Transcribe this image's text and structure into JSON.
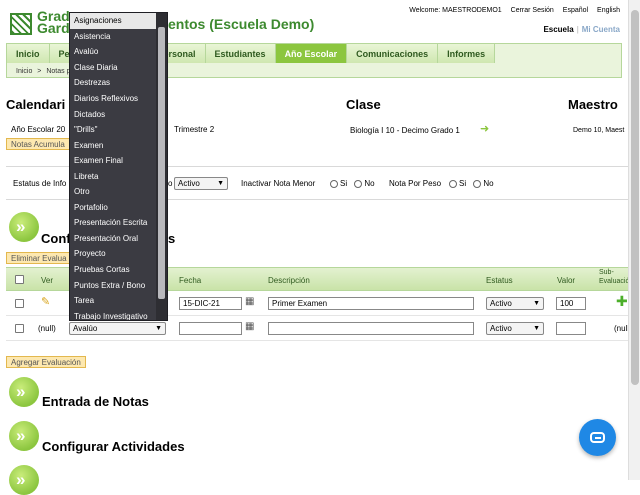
{
  "header": {
    "logo_line1": "Grade",
    "logo_line2": "Garde",
    "page_title": "entos (Escuela Demo)",
    "welcome": "Welcome: MAESTRODEMO1",
    "logout": "Cerrar Sesión",
    "lang_es": "Español",
    "lang_en": "English",
    "school_link": "Escuela",
    "account_link": "Mi Cuenta"
  },
  "nav": {
    "tabs": [
      "Inicio",
      "Per",
      "Personal",
      "Estudiantes",
      "Año Escolar",
      "Comunicaciones",
      "Informes"
    ],
    "active_tab": "Año Escolar",
    "breadcrumb_home": "Inicio",
    "breadcrumb_sep": ">",
    "breadcrumb_current": "Notas p"
  },
  "calendar": {
    "calendar_heading": "Calendari",
    "class_heading": "Clase",
    "teacher_heading": "Maestro",
    "year_value": "Año Escolar 20",
    "trimester_value": "Trimestre 2",
    "class_value": "Biología I 10 -  Decimo Grado  1",
    "teacher_value": "Demo 10, Maest",
    "accum_button": "Notas Acumula"
  },
  "filters": {
    "status_label": "Estatus de Info",
    "suffix": "o",
    "status_value": "Activo",
    "inactivate_label": "Inactivar Nota Menor",
    "weight_label": "Nota Por Peso",
    "yes": "Si",
    "no": "No"
  },
  "config_section": {
    "title_left": "Confi",
    "title_right": "s",
    "delete_button": "Eliminar Evalua",
    "add_button": "Agregar Evaluación"
  },
  "table": {
    "col_ver": "Ver",
    "col_fecha": "Fecha",
    "col_desc": "Descripción",
    "col_status": "Estatus",
    "col_valor": "Valor",
    "col_sub1": "Sub-",
    "col_sub2": "Evaluació",
    "row1_date": "15-DIC-21",
    "row1_desc": "Primer Examen",
    "row1_status": "Activo",
    "row1_valor": "100",
    "row2_ver": "(null)",
    "row2_type": "Avalúo",
    "row2_status": "Activo",
    "row2_sub": "(null"
  },
  "sections": {
    "entrada": "Entrada de Notas",
    "actividades": "Configurar Actividades"
  },
  "dropdown": {
    "items": [
      "Asignaciones",
      "Asistencia",
      "Avalúo",
      "Clase Diaria",
      "Destrezas",
      "Diarios Reflexivos",
      "Dictados",
      "\"Drills\"",
      "Examen",
      "Examen Final",
      "Libreta",
      "Otro",
      "Portafolio",
      "Presentación Escrita",
      "Presentación Oral",
      "Proyecto",
      "Pruebas Cortas",
      "Puntos Extra / Bono",
      "Tarea",
      "Trabajo Investigativo"
    ],
    "selected": "Asignaciones"
  },
  "colors": {
    "brand_green": "#3d8a2f",
    "accent_green": "#8cc63f",
    "dropdown_bg": "#3b3b42",
    "chat_blue": "#1f88e5"
  }
}
